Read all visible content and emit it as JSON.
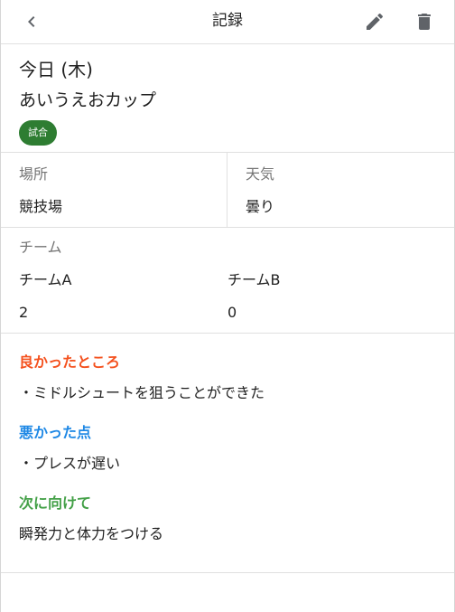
{
  "appbar": {
    "title": "記録",
    "back_icon": "chevron-left-icon",
    "edit_icon": "pencil-icon",
    "delete_icon": "trash-icon"
  },
  "record": {
    "date": "今日 (木)",
    "event_name": "あいうえおカップ",
    "badge": "試合",
    "badge_color": "#2e7d32"
  },
  "details": {
    "place_label": "場所",
    "place_value": "競技場",
    "weather_label": "天気",
    "weather_value": "曇り"
  },
  "team": {
    "label": "チーム",
    "team_a_name": "チームA",
    "team_a_score": "2",
    "team_b_name": "チームB",
    "team_b_score": "0"
  },
  "notes": {
    "good_heading": "良かったところ",
    "good_text": "・ミドルシュートを狙うことができた",
    "good_color": "#f4511e",
    "bad_heading": "悪かった点",
    "bad_text": "・プレスが遅い",
    "bad_color": "#1e88e5",
    "next_heading": "次に向けて",
    "next_text": "瞬発力と体力をつける",
    "next_color": "#43a047"
  }
}
